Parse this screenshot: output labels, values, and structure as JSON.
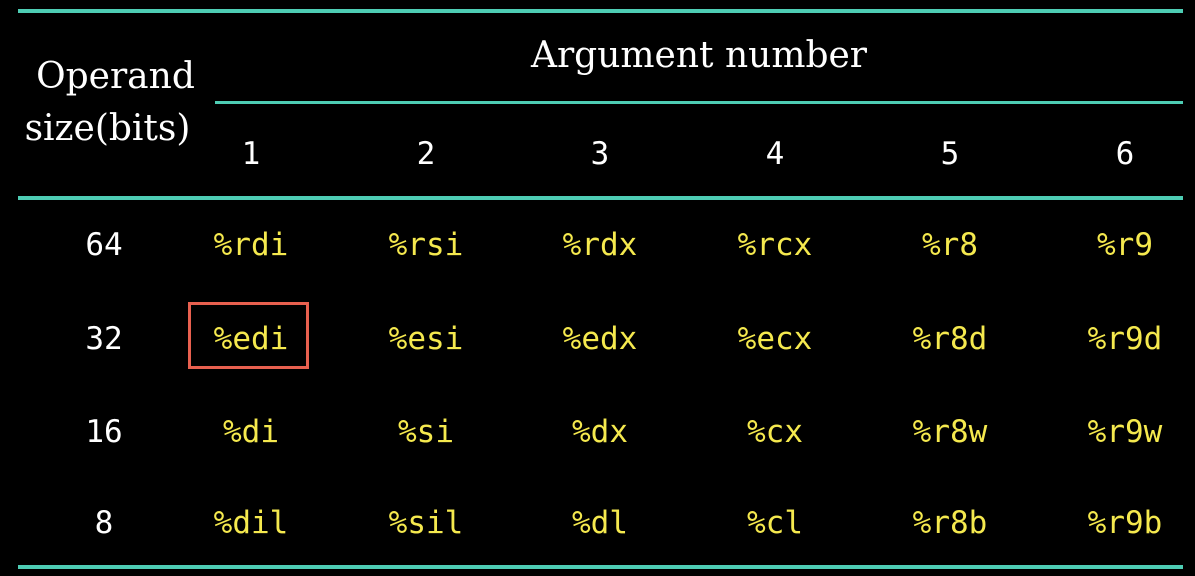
{
  "table": {
    "stub_header_line1": "Operand",
    "stub_header_line2": "size(bits)",
    "group_header": "Argument number",
    "argument_numbers": [
      "1",
      "2",
      "3",
      "4",
      "5",
      "6"
    ],
    "rows": [
      {
        "size": "64",
        "registers": [
          "%rdi",
          "%rsi",
          "%rdx",
          "%rcx",
          "%r8",
          "%r9"
        ]
      },
      {
        "size": "32",
        "registers": [
          "%edi",
          "%esi",
          "%edx",
          "%ecx",
          "%r8d",
          "%r9d"
        ]
      },
      {
        "size": "16",
        "registers": [
          "%di",
          "%si",
          "%dx",
          "%cx",
          "%r8w",
          "%r9w"
        ]
      },
      {
        "size": "8",
        "registers": [
          "%dil",
          "%sil",
          "%dl",
          "%cl",
          "%r8b",
          "%r9b"
        ]
      }
    ],
    "highlighted_cell": "%edi"
  },
  "colors": {
    "background": "#000000",
    "rule": "#4ecdb4",
    "header_text": "#ffffff",
    "register_text": "#f5e94e",
    "highlight_border": "#e8604f"
  }
}
